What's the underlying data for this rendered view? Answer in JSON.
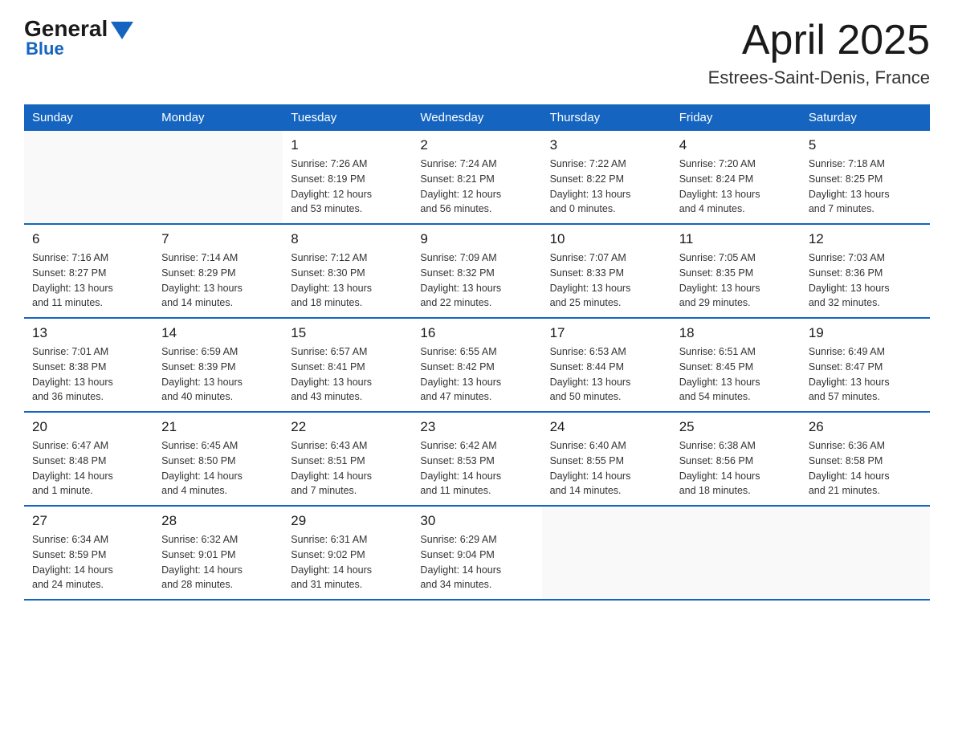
{
  "header": {
    "logo_general": "General",
    "logo_blue": "Blue",
    "month_title": "April 2025",
    "location": "Estrees-Saint-Denis, France"
  },
  "calendar": {
    "weekdays": [
      "Sunday",
      "Monday",
      "Tuesday",
      "Wednesday",
      "Thursday",
      "Friday",
      "Saturday"
    ],
    "weeks": [
      [
        {
          "day": "",
          "info": ""
        },
        {
          "day": "",
          "info": ""
        },
        {
          "day": "1",
          "info": "Sunrise: 7:26 AM\nSunset: 8:19 PM\nDaylight: 12 hours\nand 53 minutes."
        },
        {
          "day": "2",
          "info": "Sunrise: 7:24 AM\nSunset: 8:21 PM\nDaylight: 12 hours\nand 56 minutes."
        },
        {
          "day": "3",
          "info": "Sunrise: 7:22 AM\nSunset: 8:22 PM\nDaylight: 13 hours\nand 0 minutes."
        },
        {
          "day": "4",
          "info": "Sunrise: 7:20 AM\nSunset: 8:24 PM\nDaylight: 13 hours\nand 4 minutes."
        },
        {
          "day": "5",
          "info": "Sunrise: 7:18 AM\nSunset: 8:25 PM\nDaylight: 13 hours\nand 7 minutes."
        }
      ],
      [
        {
          "day": "6",
          "info": "Sunrise: 7:16 AM\nSunset: 8:27 PM\nDaylight: 13 hours\nand 11 minutes."
        },
        {
          "day": "7",
          "info": "Sunrise: 7:14 AM\nSunset: 8:29 PM\nDaylight: 13 hours\nand 14 minutes."
        },
        {
          "day": "8",
          "info": "Sunrise: 7:12 AM\nSunset: 8:30 PM\nDaylight: 13 hours\nand 18 minutes."
        },
        {
          "day": "9",
          "info": "Sunrise: 7:09 AM\nSunset: 8:32 PM\nDaylight: 13 hours\nand 22 minutes."
        },
        {
          "day": "10",
          "info": "Sunrise: 7:07 AM\nSunset: 8:33 PM\nDaylight: 13 hours\nand 25 minutes."
        },
        {
          "day": "11",
          "info": "Sunrise: 7:05 AM\nSunset: 8:35 PM\nDaylight: 13 hours\nand 29 minutes."
        },
        {
          "day": "12",
          "info": "Sunrise: 7:03 AM\nSunset: 8:36 PM\nDaylight: 13 hours\nand 32 minutes."
        }
      ],
      [
        {
          "day": "13",
          "info": "Sunrise: 7:01 AM\nSunset: 8:38 PM\nDaylight: 13 hours\nand 36 minutes."
        },
        {
          "day": "14",
          "info": "Sunrise: 6:59 AM\nSunset: 8:39 PM\nDaylight: 13 hours\nand 40 minutes."
        },
        {
          "day": "15",
          "info": "Sunrise: 6:57 AM\nSunset: 8:41 PM\nDaylight: 13 hours\nand 43 minutes."
        },
        {
          "day": "16",
          "info": "Sunrise: 6:55 AM\nSunset: 8:42 PM\nDaylight: 13 hours\nand 47 minutes."
        },
        {
          "day": "17",
          "info": "Sunrise: 6:53 AM\nSunset: 8:44 PM\nDaylight: 13 hours\nand 50 minutes."
        },
        {
          "day": "18",
          "info": "Sunrise: 6:51 AM\nSunset: 8:45 PM\nDaylight: 13 hours\nand 54 minutes."
        },
        {
          "day": "19",
          "info": "Sunrise: 6:49 AM\nSunset: 8:47 PM\nDaylight: 13 hours\nand 57 minutes."
        }
      ],
      [
        {
          "day": "20",
          "info": "Sunrise: 6:47 AM\nSunset: 8:48 PM\nDaylight: 14 hours\nand 1 minute."
        },
        {
          "day": "21",
          "info": "Sunrise: 6:45 AM\nSunset: 8:50 PM\nDaylight: 14 hours\nand 4 minutes."
        },
        {
          "day": "22",
          "info": "Sunrise: 6:43 AM\nSunset: 8:51 PM\nDaylight: 14 hours\nand 7 minutes."
        },
        {
          "day": "23",
          "info": "Sunrise: 6:42 AM\nSunset: 8:53 PM\nDaylight: 14 hours\nand 11 minutes."
        },
        {
          "day": "24",
          "info": "Sunrise: 6:40 AM\nSunset: 8:55 PM\nDaylight: 14 hours\nand 14 minutes."
        },
        {
          "day": "25",
          "info": "Sunrise: 6:38 AM\nSunset: 8:56 PM\nDaylight: 14 hours\nand 18 minutes."
        },
        {
          "day": "26",
          "info": "Sunrise: 6:36 AM\nSunset: 8:58 PM\nDaylight: 14 hours\nand 21 minutes."
        }
      ],
      [
        {
          "day": "27",
          "info": "Sunrise: 6:34 AM\nSunset: 8:59 PM\nDaylight: 14 hours\nand 24 minutes."
        },
        {
          "day": "28",
          "info": "Sunrise: 6:32 AM\nSunset: 9:01 PM\nDaylight: 14 hours\nand 28 minutes."
        },
        {
          "day": "29",
          "info": "Sunrise: 6:31 AM\nSunset: 9:02 PM\nDaylight: 14 hours\nand 31 minutes."
        },
        {
          "day": "30",
          "info": "Sunrise: 6:29 AM\nSunset: 9:04 PM\nDaylight: 14 hours\nand 34 minutes."
        },
        {
          "day": "",
          "info": ""
        },
        {
          "day": "",
          "info": ""
        },
        {
          "day": "",
          "info": ""
        }
      ]
    ]
  }
}
